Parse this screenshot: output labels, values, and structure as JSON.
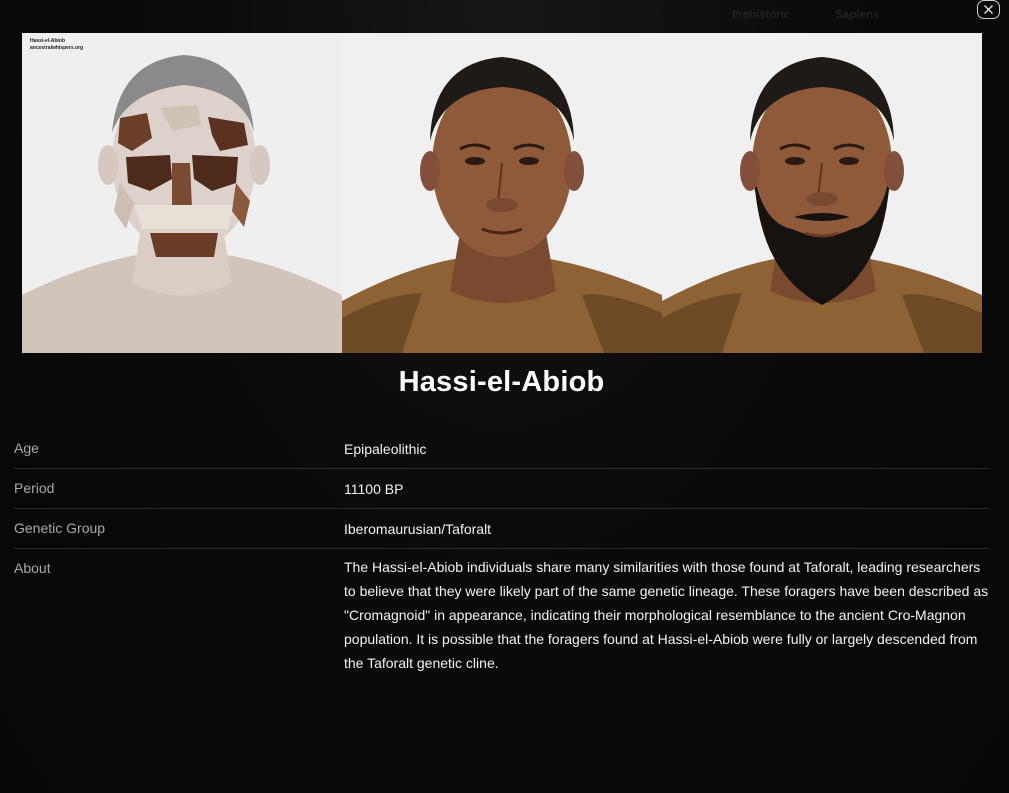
{
  "background_nav": {
    "items": [
      "Prehistoric",
      "Sapiens"
    ]
  },
  "close": {
    "icon": "close-icon",
    "label": "×"
  },
  "images": [
    {
      "name": "skull-reconstruction-overlay",
      "watermark_line1": "Hassi-el-Abiob",
      "watermark_line2": "ancestralwhispers.org"
    },
    {
      "name": "face-reconstruction"
    },
    {
      "name": "bearded-reconstruction"
    }
  ],
  "title": "Hassi-el-Abiob",
  "details": {
    "age": {
      "label": "Age",
      "value": "Epipaleolithic"
    },
    "period": {
      "label": "Period",
      "value": "11100 BP"
    },
    "genetic_group": {
      "label": "Genetic Group",
      "value": "Iberomaurusian/Taforalt"
    },
    "about": {
      "label": "About",
      "value": "The Hassi-el-Abiob individuals share many similarities with those found at Taforalt, leading researchers to believe that they were likely part of the same genetic lineage. These foragers have been described as \"Cromagnoid\" in appearance, indicating their morphological resemblance to the ancient Cro-Magnon population. It is possible that the foragers found at Hassi-el-Abiob were fully or largely descended from the Taforalt genetic cline."
    }
  },
  "colors": {
    "background": "#0b0b0b",
    "text": "#f2f2f2",
    "label": "#a9a9a9",
    "divider": "#2c2c2c"
  }
}
